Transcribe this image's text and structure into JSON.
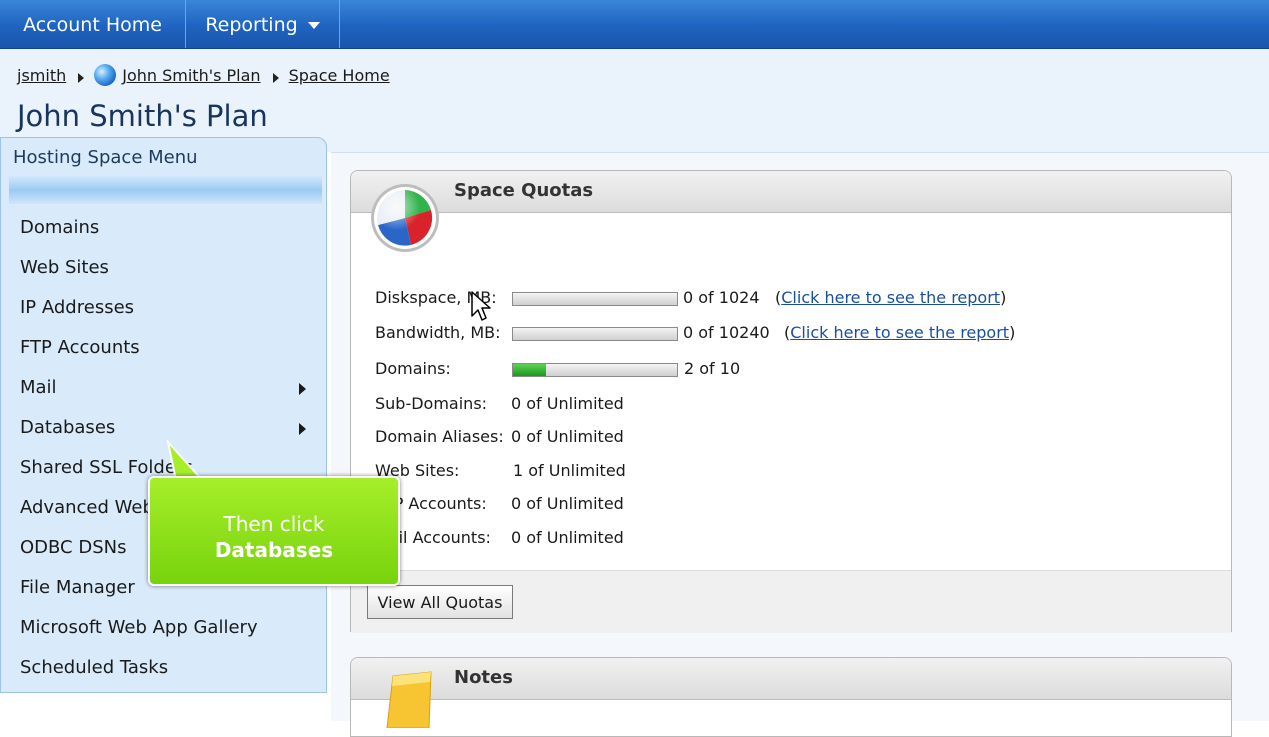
{
  "nav": {
    "account_home": "Account Home",
    "reporting": "Reporting"
  },
  "breadcrumb": {
    "user": "jsmith",
    "plan": "John Smith's Plan",
    "space_home": "Space Home"
  },
  "page_title": "John Smith's Plan",
  "sidebar": {
    "title": "Hosting Space Menu",
    "items": [
      {
        "label": "Domains",
        "submenu": false
      },
      {
        "label": "Web Sites",
        "submenu": false
      },
      {
        "label": "IP Addresses",
        "submenu": false
      },
      {
        "label": "FTP Accounts",
        "submenu": false
      },
      {
        "label": "Mail",
        "submenu": true
      },
      {
        "label": "Databases",
        "submenu": true
      },
      {
        "label": "Shared SSL Folders",
        "submenu": false
      },
      {
        "label": "Advanced Web",
        "submenu": false
      },
      {
        "label": "ODBC DSNs",
        "submenu": false
      },
      {
        "label": "File Manager",
        "submenu": false
      },
      {
        "label": "Microsoft Web App Gallery",
        "submenu": false
      },
      {
        "label": "Scheduled Tasks",
        "submenu": false
      }
    ]
  },
  "quotas": {
    "title": "Space Quotas",
    "report_link": "Click here to see the report",
    "rows": [
      {
        "label": "Diskspace, MB:",
        "value": "0 of 1024",
        "fraction": 0.0
      },
      {
        "label": "Bandwidth, MB:",
        "value": "0 of 10240",
        "fraction": 0.0
      },
      {
        "label": "Domains:",
        "value": "2 of 10",
        "fraction": 0.2
      },
      {
        "label": "Sub-Domains:",
        "value": "0 of Unlimited"
      },
      {
        "label": "Domain Aliases:",
        "value": "0 of Unlimited"
      },
      {
        "label": "Web Sites:",
        "value": "1 of Unlimited"
      },
      {
        "label": "FTP Accounts:",
        "value": "0 of Unlimited"
      },
      {
        "label": "Mail Accounts:",
        "value": "0 of Unlimited"
      }
    ],
    "view_all_button": "View All Quotas"
  },
  "notes": {
    "title": "Notes"
  },
  "callout": {
    "line1": "Then click",
    "line2": "Databases"
  },
  "colors": {
    "nav_blue": "#1f63c0",
    "callout_green": "#8be01c",
    "progress_green": "#1a9a1a"
  }
}
